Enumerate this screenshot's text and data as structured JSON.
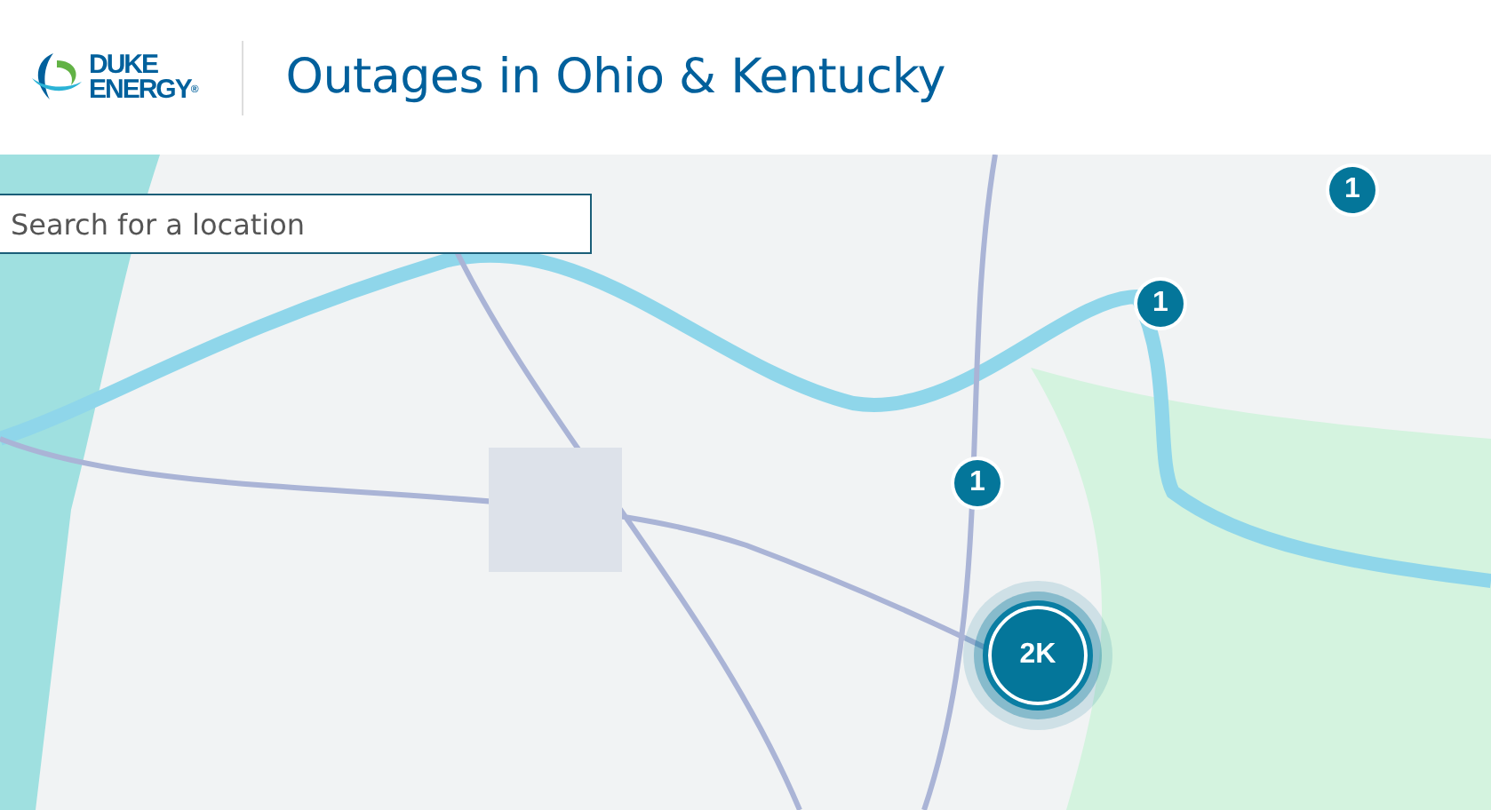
{
  "header": {
    "logo": {
      "line_1": "DUKE",
      "line_2": "ENERGY",
      "mark": "®"
    },
    "title": "Outages in Ohio & Kentucky"
  },
  "search": {
    "placeholder": "Search for a location"
  },
  "markers": [
    {
      "kind": "single",
      "count": "1"
    },
    {
      "kind": "single",
      "count": "1"
    },
    {
      "kind": "single",
      "count": "1"
    },
    {
      "kind": "cluster",
      "count": "2K"
    }
  ]
}
